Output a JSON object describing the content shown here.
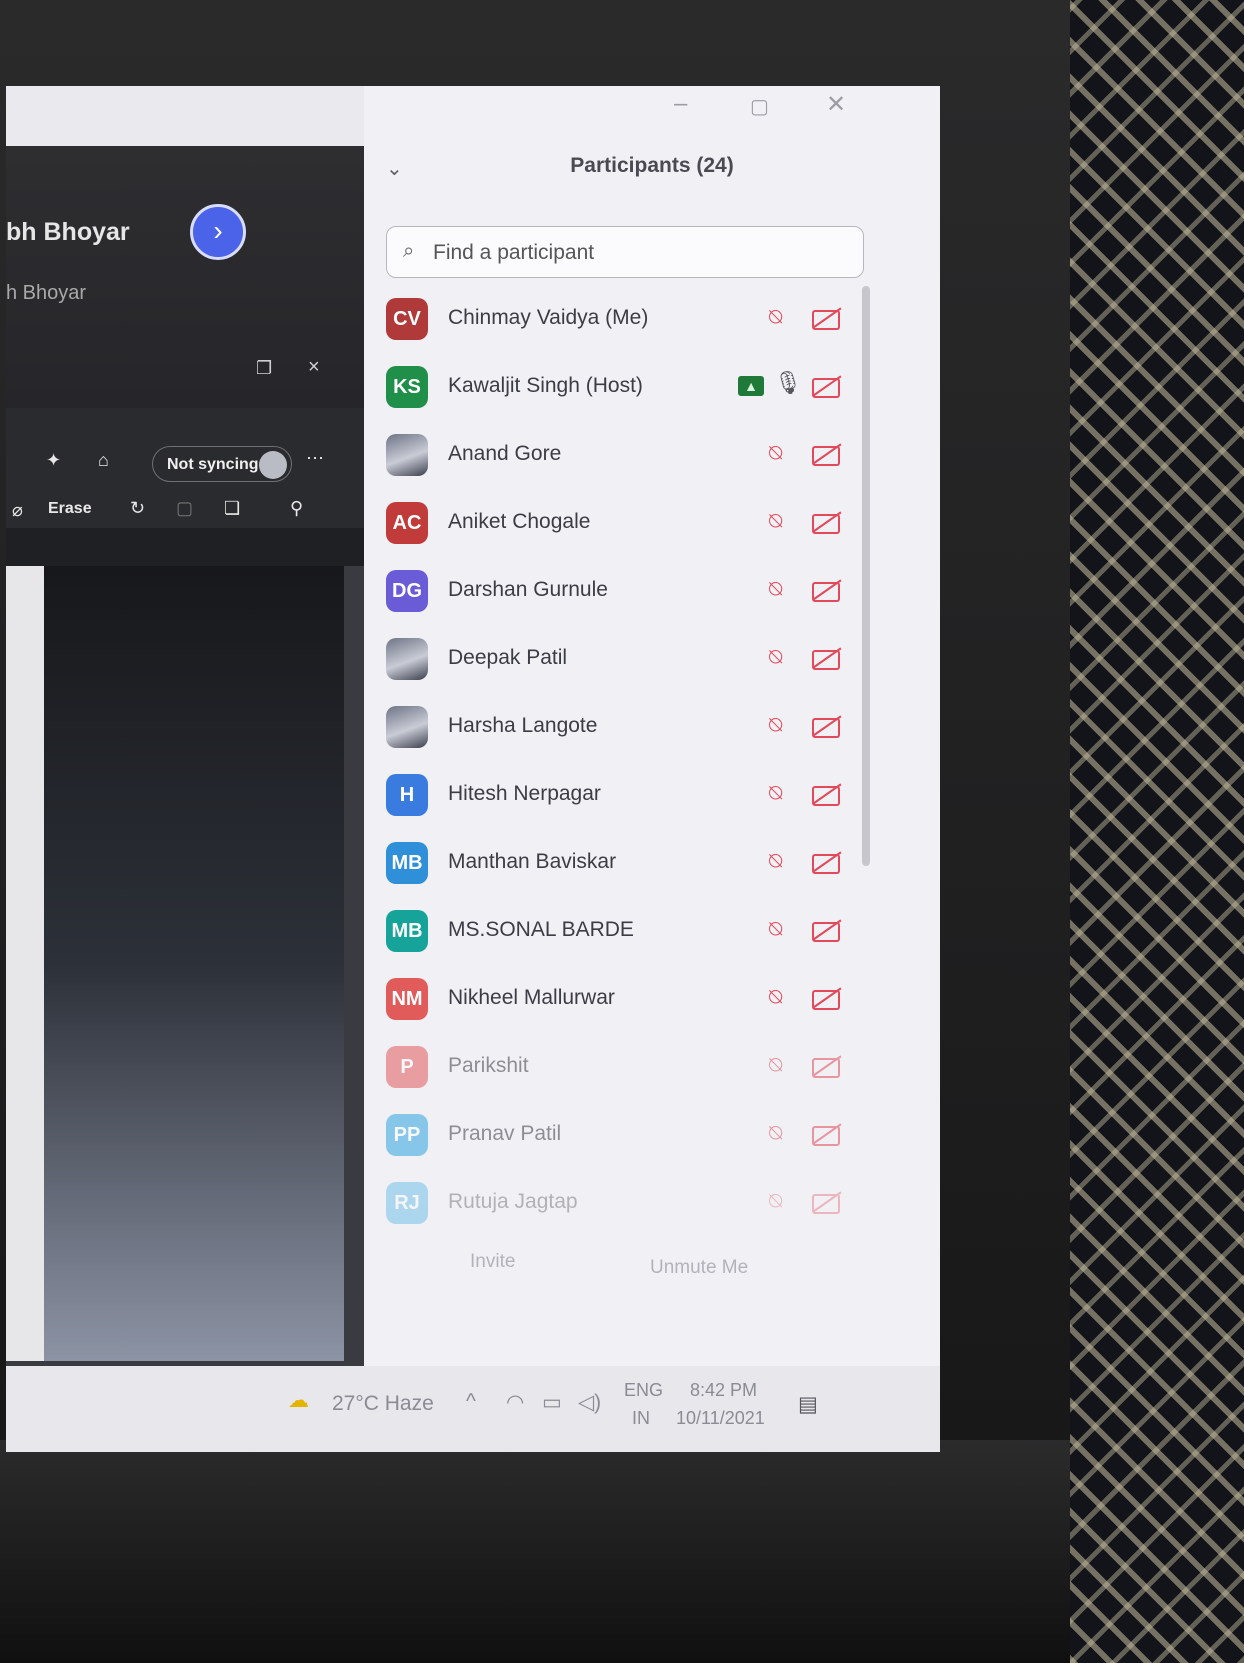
{
  "left_window": {
    "name_partial": "bh Bhoyar",
    "sub_partial": "h Bhoyar",
    "sync_status": "Not syncing",
    "erase_label": "Erase"
  },
  "panel": {
    "title": "Participants (24)",
    "search_placeholder": "Find a participant",
    "participants": [
      {
        "initials": "CV",
        "name": "Chinmay Vaidya (Me)",
        "color": "#b03a3a"
      },
      {
        "initials": "KS",
        "name": "Kawaljit Singh (Host)",
        "color": "#1f8f4a"
      },
      {
        "initials": "",
        "name": "Anand Gore",
        "color": "#8a8fa0"
      },
      {
        "initials": "AC",
        "name": "Aniket Chogale",
        "color": "#c23b3b"
      },
      {
        "initials": "DG",
        "name": "Darshan Gurnule",
        "color": "#6a5bd6"
      },
      {
        "initials": "",
        "name": "Deepak Patil",
        "color": "#8a8fa0"
      },
      {
        "initials": "",
        "name": "Harsha Langote",
        "color": "#8a8fa0"
      },
      {
        "initials": "H",
        "name": "Hitesh Nerpagar",
        "color": "#3a7be0"
      },
      {
        "initials": "MB",
        "name": "Manthan Baviskar",
        "color": "#2f8fd8"
      },
      {
        "initials": "MB",
        "name": "MS.SONAL BARDE",
        "color": "#16a39a"
      },
      {
        "initials": "NM",
        "name": "Nikheel Mallurwar",
        "color": "#e15b5b"
      },
      {
        "initials": "P",
        "name": "Parikshit",
        "color": "#e15b5b"
      },
      {
        "initials": "PP",
        "name": "Pranav Patil",
        "color": "#2fa6e0"
      },
      {
        "initials": "RJ",
        "name": "Rutuja Jagtap",
        "color": "#2fa6e0"
      }
    ],
    "invite_label": "Invite",
    "unmute_label": "Unmute Me"
  },
  "taskbar": {
    "weather": "27°C  Haze",
    "lang_top": "ENG",
    "lang_bottom": "IN",
    "time": "8:42 PM",
    "date": "10/11/2021"
  }
}
